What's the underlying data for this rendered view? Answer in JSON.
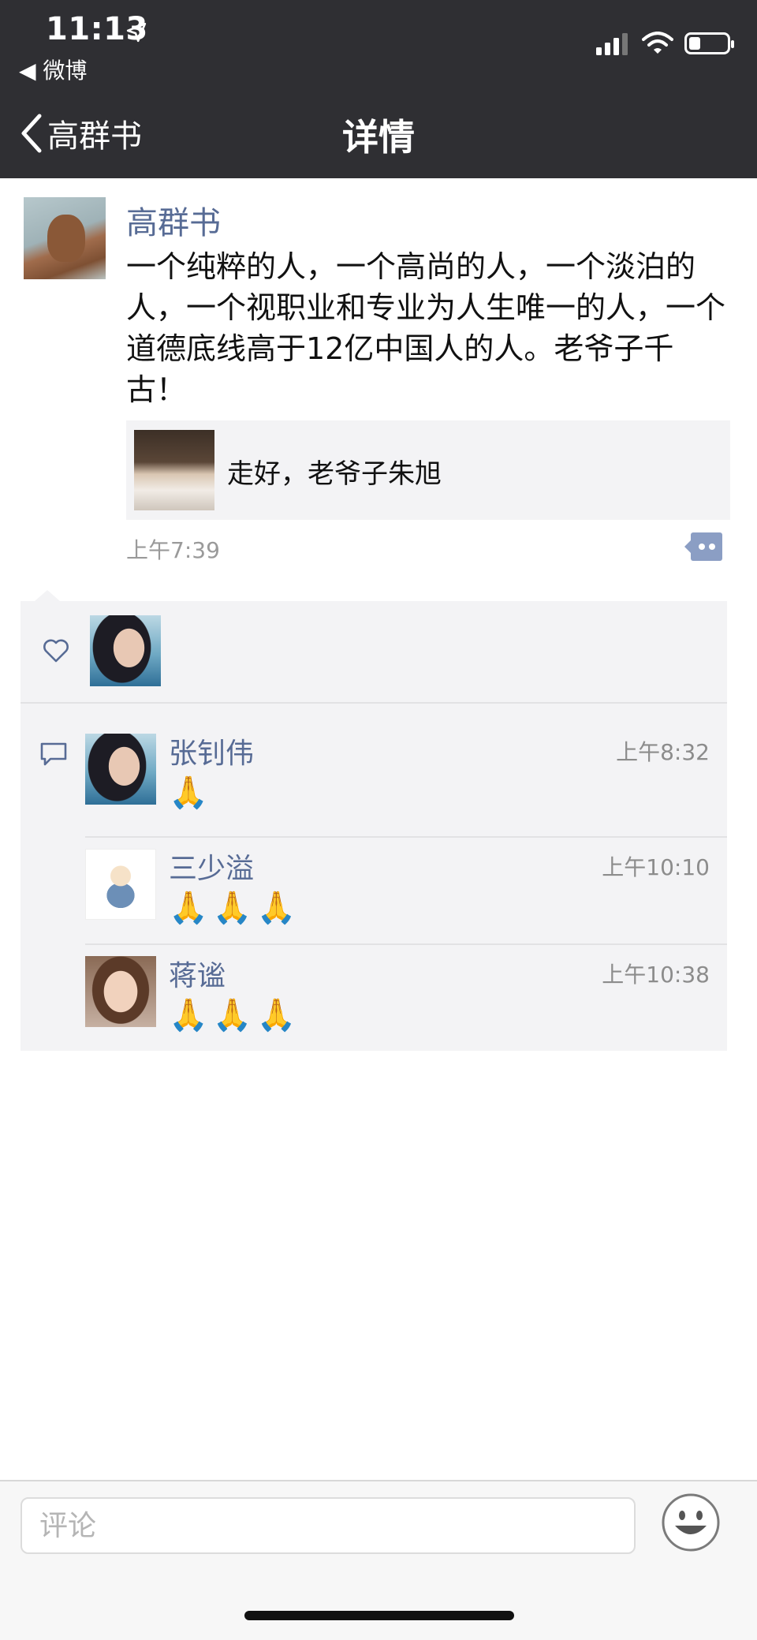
{
  "status_bar": {
    "time": "11:13",
    "back_app": "◀ 微博"
  },
  "nav": {
    "back_label": "高群书",
    "title": "详情"
  },
  "post": {
    "author": "高群书",
    "text": "一个纯粹的人，一个高尚的人，一个淡泊的人，一个视职业和专业为人生唯一的人，一个道德底线高于12亿中国人的人。老爷子千古！",
    "link": {
      "title": "走好，老爷子朱旭"
    },
    "time": "上午7:39"
  },
  "likes": {
    "avatar_icon": "avatar"
  },
  "comments": [
    {
      "name": "张钊伟",
      "time": "上午8:32",
      "text": "🙏"
    },
    {
      "name": "三少溢",
      "time": "上午10:10",
      "text": "🙏🙏🙏"
    },
    {
      "name": "蒋谧",
      "time": "上午10:38",
      "text": "🙏🙏🙏"
    }
  ],
  "input": {
    "placeholder": "评论"
  },
  "colors": {
    "nav_bg": "#2f2f33",
    "link_blue": "#576b95",
    "panel_bg": "#f3f3f5"
  }
}
